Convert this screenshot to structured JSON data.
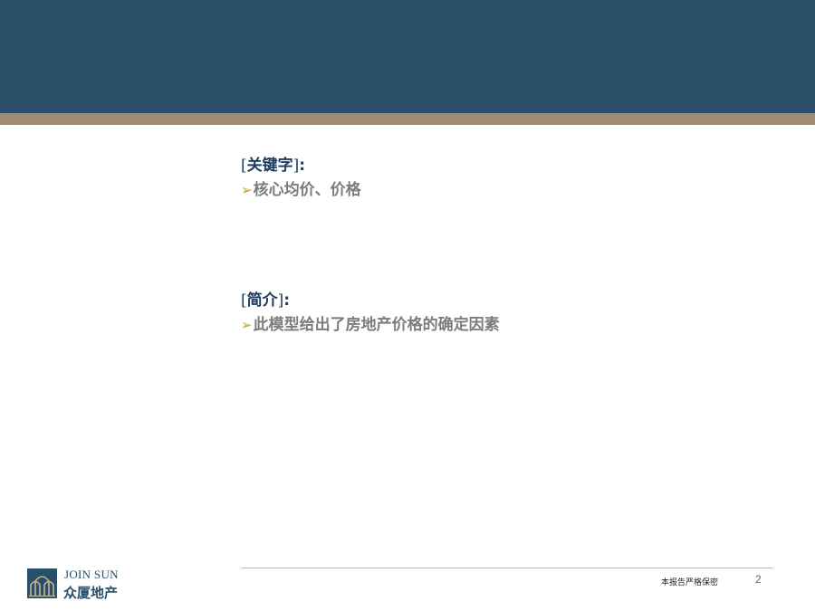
{
  "sections": [
    {
      "title": "关键字",
      "colon": ":",
      "bullet": "核心均价、价格"
    },
    {
      "title": "简介",
      "colon": ":",
      "bullet": "此模型给出了房地产价格的确定因素"
    }
  ],
  "bracket_open": "[",
  "bracket_close": "]",
  "bullet_icon": "arrow-bullet-icon",
  "footer": {
    "confidential": "本报告严格保密",
    "page_number": "2"
  },
  "logo": {
    "english": "JOIN SUN",
    "chinese": "众厦地产"
  },
  "colors": {
    "header": "#2a4f68",
    "stripe": "#a08c70",
    "title": "#1d3b5c",
    "bullet_text": "#7c7c7c",
    "arrow": "#c9a225"
  }
}
